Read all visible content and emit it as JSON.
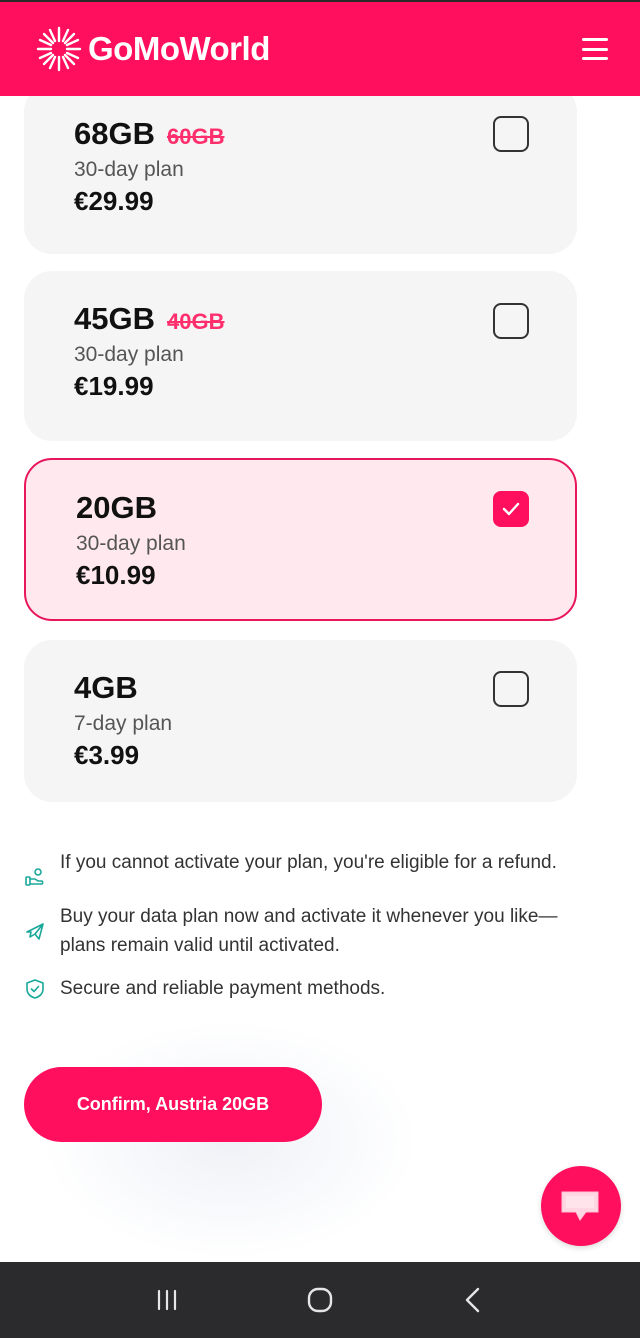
{
  "header": {
    "logo_text": "GoMoWorld",
    "menu_icon": "hamburger-menu-icon",
    "brand_color": "#ff0f5e"
  },
  "plans": [
    {
      "size": "68GB",
      "old_size": "60GB",
      "duration": "30-day plan",
      "price": "€29.99",
      "selected": false
    },
    {
      "size": "45GB",
      "old_size": "40GB",
      "duration": "30-day plan",
      "price": "€19.99",
      "selected": false
    },
    {
      "size": "20GB",
      "old_size": "",
      "duration": "30-day plan",
      "price": "€10.99",
      "selected": true
    },
    {
      "size": "4GB",
      "old_size": "",
      "duration": "7-day plan",
      "price": "€3.99",
      "selected": false
    }
  ],
  "benefits": [
    {
      "icon": "refund-hand-icon",
      "text": "If you cannot activate your plan, you're eligible for a refund."
    },
    {
      "icon": "airplane-icon",
      "text": "Buy your data plan now and activate it whenever you like—plans remain valid until activated."
    },
    {
      "icon": "shield-check-icon",
      "text": "Secure and reliable payment methods."
    }
  ],
  "confirm_button": {
    "label": "Confirm, Austria 20GB"
  },
  "chat": {
    "icon": "chat-bubble-icon"
  },
  "system_nav": {
    "recents_icon": "recent-apps-icon",
    "home_icon": "home-icon",
    "back_icon": "back-icon"
  }
}
